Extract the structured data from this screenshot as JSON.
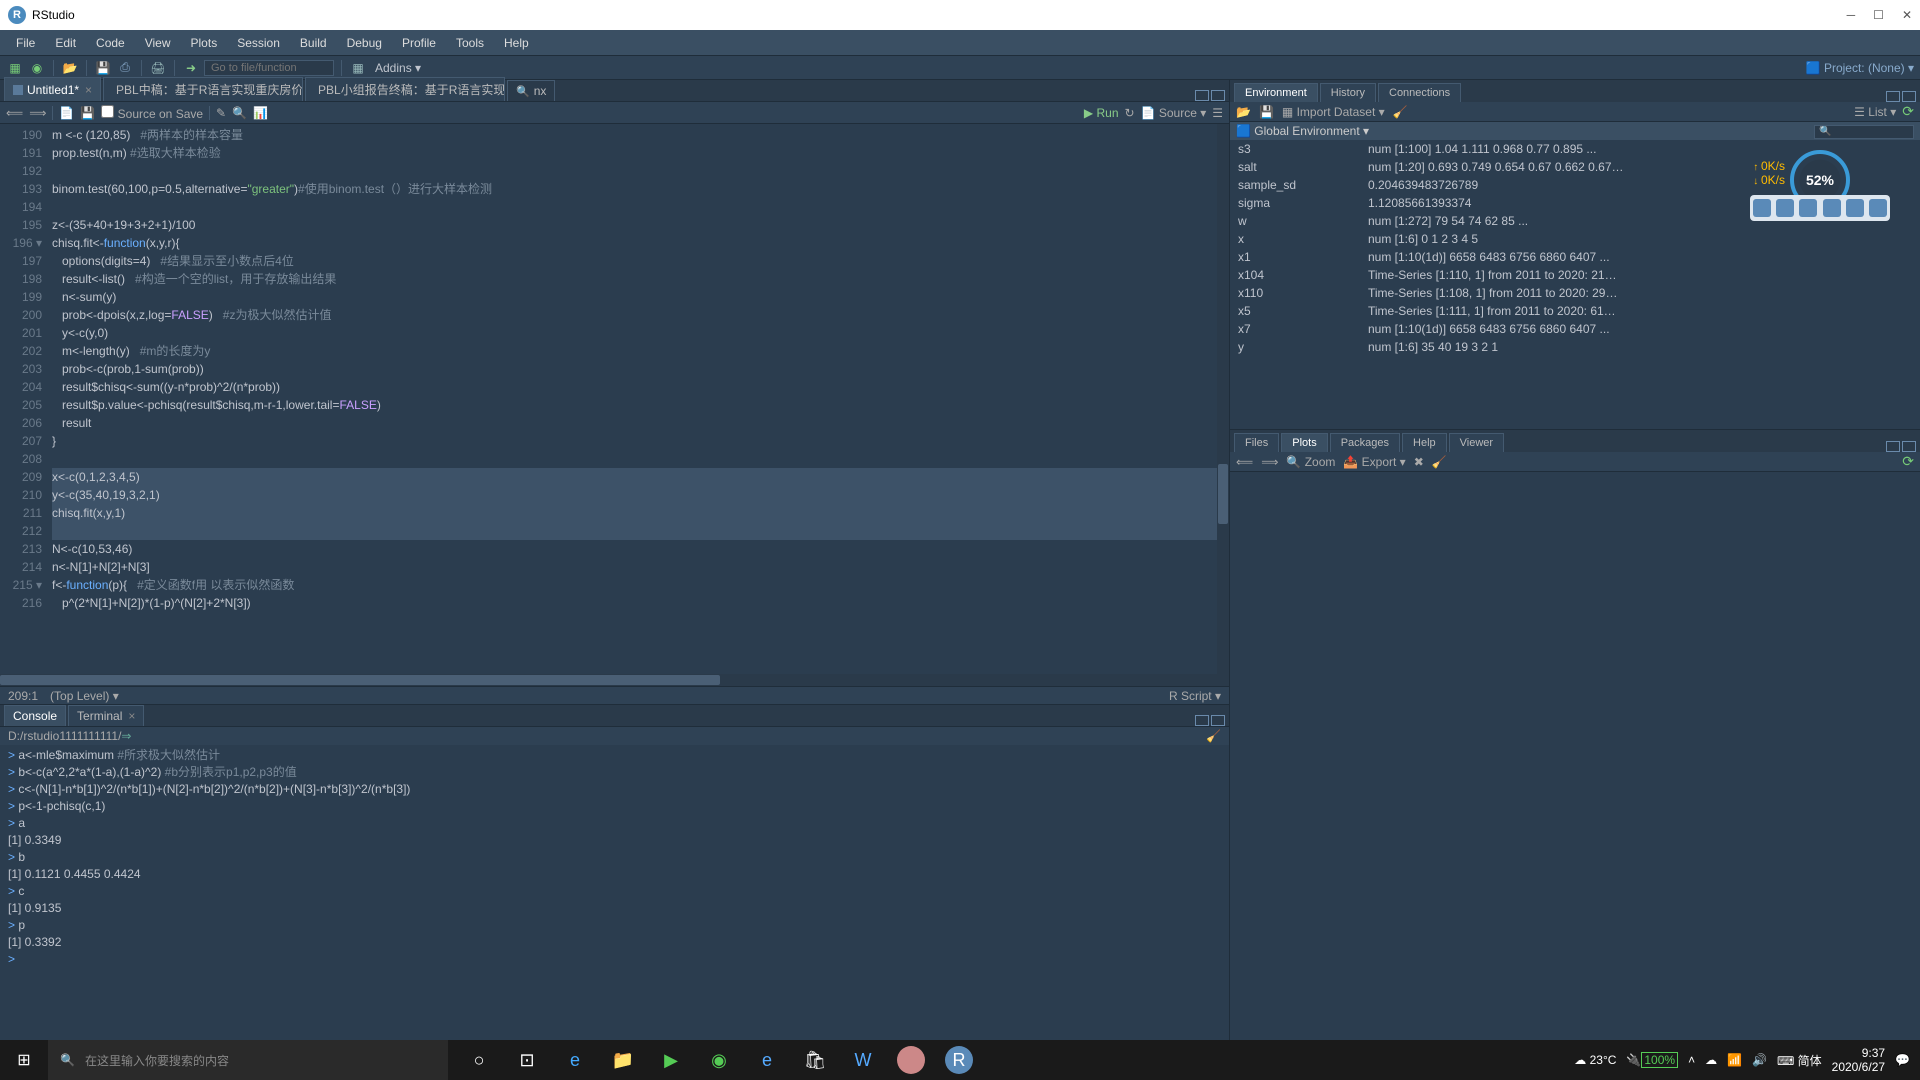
{
  "window": {
    "title": "RStudio"
  },
  "menu": [
    "File",
    "Edit",
    "Code",
    "View",
    "Plots",
    "Session",
    "Build",
    "Debug",
    "Profile",
    "Tools",
    "Help"
  ],
  "maintoolbar": {
    "goto_placeholder": "Go to file/function",
    "addins": "Addins",
    "project": "Project: (None)"
  },
  "source": {
    "tabs": [
      {
        "label": "Untitled1*",
        "active": true
      },
      {
        "label": "PBL中稿：基于R语言实现重庆房价走势…",
        "active": false
      },
      {
        "label": "PBL小组报告终稿：基于R语言实现重庆…",
        "active": false
      }
    ],
    "find_value": "nx",
    "toolbar": {
      "source_on_save": "Source on Save",
      "run": "Run",
      "source_btn": "Source"
    },
    "lines": [
      {
        "n": 190,
        "html": "m <-c (120,85)   <span class='cm'>#两样本的样本容量</span>"
      },
      {
        "n": 191,
        "html": "prop.test(n,m) <span class='cm'>#选取大样本检验</span>"
      },
      {
        "n": 192,
        "html": ""
      },
      {
        "n": 193,
        "html": "binom.test(60,100,p=0.5,alternative=<span class='str'>\"greater\"</span>)<span class='cm'>#使用binom.test（）进行大样本检测</span>"
      },
      {
        "n": 194,
        "html": ""
      },
      {
        "n": 195,
        "html": "z<-(35+40+19+3+2+1)/100"
      },
      {
        "n": 196,
        "html": "chisq.fit<-<span class='kw'>function</span>(x,y,r){",
        "fold": true
      },
      {
        "n": 197,
        "html": "   options(digits=4)   <span class='cm'>#结果显示至小数点后4位</span>"
      },
      {
        "n": 198,
        "html": "   result<-list()   <span class='cm'>#构造一个空的list，用于存放输出结果</span>"
      },
      {
        "n": 199,
        "html": "   n<-sum(y)"
      },
      {
        "n": 200,
        "html": "   prob<-dpois(x,z,log=<span class='bool'>FALSE</span>)   <span class='cm'>#z为极大似然估计值</span>"
      },
      {
        "n": 201,
        "html": "   y<-c(y,0)"
      },
      {
        "n": 202,
        "html": "   m<-length(y)   <span class='cm'>#m的长度为y</span>"
      },
      {
        "n": 203,
        "html": "   prob<-c(prob,1-sum(prob))"
      },
      {
        "n": 204,
        "html": "   result$chisq<-sum((y-n*prob)^2/(n*prob))"
      },
      {
        "n": 205,
        "html": "   result$p.value<-pchisq(result$chisq,m-r-1,lower.tail=<span class='bool'>FALSE</span>)"
      },
      {
        "n": 206,
        "html": "   result"
      },
      {
        "n": 207,
        "html": "}"
      },
      {
        "n": 208,
        "html": ""
      },
      {
        "n": 209,
        "html": "x<-c(0,1,2,3,4,5)",
        "sel": true
      },
      {
        "n": 210,
        "html": "y<-c(35,40,19,3,2,1)",
        "sel": true
      },
      {
        "n": 211,
        "html": "chisq.fit(x,y,1)",
        "sel": true
      },
      {
        "n": 212,
        "html": "",
        "sel": true
      },
      {
        "n": 213,
        "html": "N<-c(10,53,46)"
      },
      {
        "n": 214,
        "html": "n<-N[1]+N[2]+N[3]"
      },
      {
        "n": 215,
        "html": "f<-<span class='kw'>function</span>(p){   <span class='cm'>#定义函数f用 以表示似然函数</span>",
        "fold": true
      },
      {
        "n": 216,
        "html": "   p^(2*N[1]+N[2])*(1-p)^(N[2]+2*N[3])"
      }
    ],
    "status": {
      "pos": "209:1",
      "scope": "(Top Level)",
      "lang": "R Script"
    }
  },
  "console": {
    "tabs": [
      "Console",
      "Terminal"
    ],
    "path": "D:/rstudio1111111111/",
    "lines": [
      {
        "p": ">",
        "t": "a<-mle$maximum   ",
        "c": "#所求极大似然估计"
      },
      {
        "p": ">",
        "t": "b<-c(a^2,2*a*(1-a),(1-a)^2)   ",
        "c": "#b分别表示p1,p2,p3的值"
      },
      {
        "p": ">",
        "t": "c<-(N[1]-n*b[1])^2/(n*b[1])+(N[2]-n*b[2])^2/(n*b[2])+(N[3]-n*b[3])^2/(n*b[3])"
      },
      {
        "p": ">",
        "t": "p<-1-pchisq(c,1)"
      },
      {
        "p": ">",
        "t": "a"
      },
      {
        "o": "[1] 0.3349"
      },
      {
        "p": ">",
        "t": "b"
      },
      {
        "o": "[1] 0.1121 0.4455 0.4424"
      },
      {
        "p": ">",
        "t": "c"
      },
      {
        "o": "[1] 0.9135"
      },
      {
        "p": ">",
        "t": "p"
      },
      {
        "o": "[1] 0.3392"
      },
      {
        "p": ">",
        "t": ""
      }
    ]
  },
  "env": {
    "tabs": [
      "Environment",
      "History",
      "Connections"
    ],
    "toolbar": {
      "import": "Import Dataset",
      "list": "List"
    },
    "scope": "Global Environment",
    "vars": [
      {
        "name": "s3",
        "val": "num [1:100] 1.04 1.111 0.968 0.77 0.895 ..."
      },
      {
        "name": "salt",
        "val": "num [1:20] 0.693 0.749 0.654 0.67 0.662 0.67…"
      },
      {
        "name": "sample_sd",
        "val": "0.204639483726789"
      },
      {
        "name": "sigma",
        "val": "1.12085661393374"
      },
      {
        "name": "w",
        "val": "num [1:272] 79 54 74 62 85 ..."
      },
      {
        "name": "x",
        "val": "num [1:6] 0 1 2 3 4 5"
      },
      {
        "name": "x1",
        "val": "num [1:10(1d)] 6658 6483 6756 6860 6407 ..."
      },
      {
        "name": "x104",
        "val": "Time-Series [1:110, 1] from 2011 to 2020: 21…"
      },
      {
        "name": "x110",
        "val": "Time-Series [1:108, 1] from 2011 to 2020: 29…"
      },
      {
        "name": "x5",
        "val": "Time-Series [1:111, 1] from 2011 to 2020: 61…"
      },
      {
        "name": "x7",
        "val": "num [1:10(1d)] 6658 6483 6756 6860 6407 ..."
      },
      {
        "name": "y",
        "val": "num [1:6] 35 40 19 3 2 1"
      }
    ]
  },
  "plots": {
    "tabs": [
      "Files",
      "Plots",
      "Packages",
      "Help",
      "Viewer"
    ],
    "toolbar": {
      "zoom": "Zoom",
      "export": "Export"
    }
  },
  "overlay": {
    "gauge": "52%",
    "up": "0K/s",
    "down": "0K/s"
  },
  "taskbar": {
    "search_placeholder": "在这里输入你要搜索的内容",
    "temp": "23°C",
    "battery": "100%",
    "ime": "简体",
    "time": "9:37",
    "date": "2020/6/27"
  }
}
